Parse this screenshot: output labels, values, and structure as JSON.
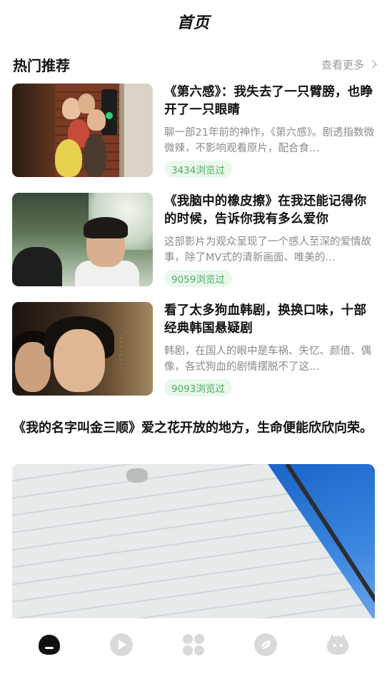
{
  "header": {
    "title": "首页"
  },
  "section": {
    "title": "热门推荐",
    "more_label": "查看更多"
  },
  "articles": [
    {
      "title": "《第六感》：我失去了一只臂膀，也睁开了一只眼睛",
      "desc": "聊一部21年前的神作，《第六感》。剧透指数微微辣，不影响观看原片，配合食…",
      "views": "3434浏览过"
    },
    {
      "title": "《我脑中的橡皮擦》在我还能记得你的时候，告诉你我有多么爱你",
      "desc": "这部影片为观众呈现了一个感人至深的爱情故事，除了MV式的清新画面、唯美的…",
      "views": "9059浏览过"
    },
    {
      "title": "看了太多狗血韩剧，换换口味，十部经典韩国悬疑剧",
      "desc": "韩剧，在国人的眼中是车祸、失忆、颜值、偶像，各式狗血的剧情摆脱不了这…",
      "views": "9093浏览过"
    }
  ],
  "feature": {
    "title": "《我的名字叫金三顺》爱之花开放的地方，生命便能欣欣向荣。"
  },
  "tabbar": {
    "items": [
      {
        "icon": "home-icon",
        "active": true
      },
      {
        "icon": "play-icon",
        "active": false
      },
      {
        "icon": "grid-icon",
        "active": false
      },
      {
        "icon": "leaf-icon",
        "active": false
      },
      {
        "icon": "profile-icon",
        "active": false
      }
    ]
  },
  "colors": {
    "badge_text": "#4fae62",
    "badge_bg": "#eaf7ec",
    "tab_inactive": "#d9d9d9",
    "tab_active": "#111111"
  }
}
